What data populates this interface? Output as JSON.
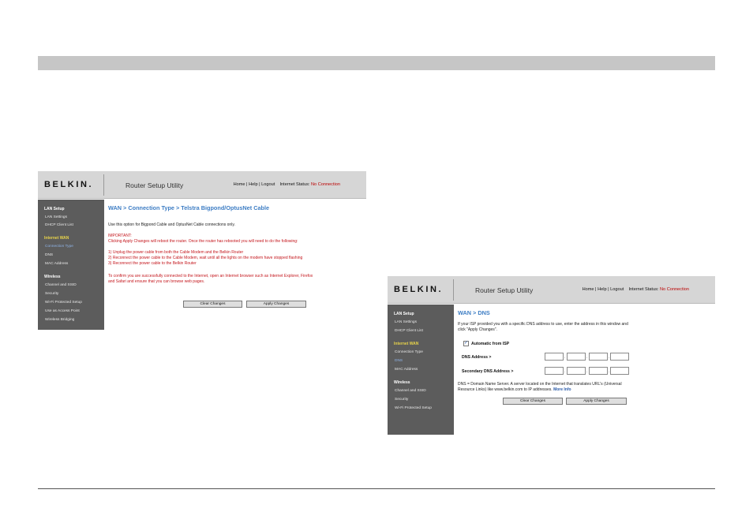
{
  "header": {
    "logo": "BELKIN",
    "logo_mark": ".",
    "title": "Router Setup Utility",
    "home": "Home",
    "help": "Help",
    "logout": "Logout",
    "sep": "|",
    "status_label": "Internet Status:",
    "status_value": "No Connection"
  },
  "sidebar": {
    "lan_setup": "LAN Setup",
    "lan_settings": "LAN Settings",
    "dhcp_client_list": "DHCP Client List",
    "internet_wan": "Internet WAN",
    "connection_type": "Connection Type",
    "dns": "DNS",
    "mac_address": "MAC Address",
    "wireless": "Wireless",
    "channel_ssid": "Channel and SSID",
    "security": "Security",
    "wifi_protected_setup": "Wi-Fi Protected Setup",
    "use_as_access_point": "Use as Access Point",
    "wireless_bridging": "Wireless Bridging"
  },
  "screen1": {
    "breadcrumb": "WAN > Connection Type > Telstra Bigpond/OptusNet Cable",
    "intro": "Use this option for Bigpond Cable and OptusNet Cable connections only.",
    "important_head": "IMPORTANT:",
    "important_line": "Clicking Apply Changes will reboot the router. Once the router has rebooted you will need to do the following:",
    "step1": "1) Unplug the power cable from both the Cable Modem and the Belkin Router",
    "step2": "2) Reconnect the power cable to the Cable Modem, wait until all the lights on the modem have stopped flashing",
    "step3": "3) Reconnect the power cable to the Belkin Router",
    "confirm1": "To confirm you are successfully connected to the Internet, open an Internet browser such as Internet Explorer, Firefox",
    "confirm2": "and Safari and ensure that you can browse web pages.",
    "clear": "Clear Changes",
    "apply": "Apply Changes"
  },
  "screen2": {
    "breadcrumb": "WAN > DNS",
    "intro1": "If your ISP provided you with a specific DNS address to use, enter the address in this window and",
    "intro2": "click \"Apply Changes\".",
    "automatic": "Automatic from ISP",
    "automatic_mark": "✓",
    "dns_label": "DNS Address >",
    "secondary_label": "Secondary DNS Address >",
    "ip_dot": ".",
    "note1": "DNS = Domain Name Server. A server located on the Internet that translates URL's (Universal",
    "note2": "Resource Links) like www.belkin.com to IP addresses.",
    "more_info": "More Info",
    "clear": "Clear Changes",
    "apply": "Apply Changes"
  }
}
